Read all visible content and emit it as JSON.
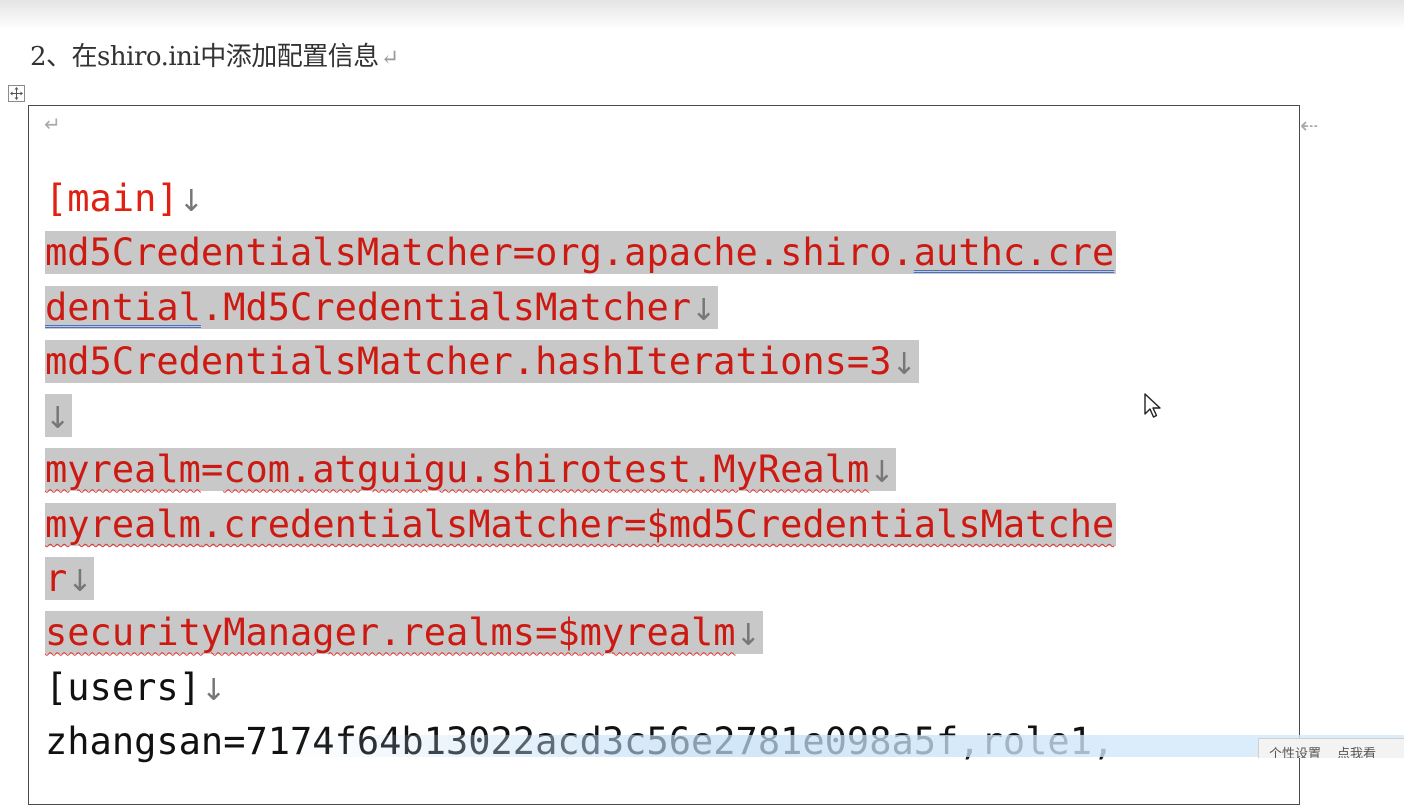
{
  "heading": "2、在shiro.ini中添加配置信息",
  "marks": {
    "paragraph": "↵",
    "cell_end": "⇠",
    "line_break": "↓"
  },
  "code": {
    "main_section": "[main]",
    "matcher_decl_part1": "md5CredentialsMatcher=org.apache.shiro.",
    "matcher_decl_link1": "authc.cre",
    "matcher_decl_link2": "dential",
    "matcher_decl_part2": ".Md5CredentialsMatcher",
    "hash_iterations": "md5CredentialsMatcher.hashIterations=3",
    "realm_prefix": "myrealm",
    "realm_eq": "=",
    "realm_class": "com.atguigu.shirotest.MyRealm",
    "realm_matcher_a": "myrealm",
    "realm_matcher_b": ".credentialsMatcher=$md5CredentialsMatche",
    "realm_matcher_c": "r",
    "security_a": "securityManager.realms=$",
    "security_b": "myrealm",
    "users_section": "[users]",
    "users_line": "zhangsan=7174f64b13022acd3c56e2781e098a5f,role1,"
  },
  "status_bar": {
    "item1": "个性设置",
    "item2": "点我看"
  }
}
